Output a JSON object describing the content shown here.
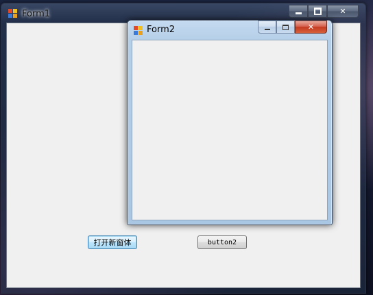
{
  "form1": {
    "title": "Form1",
    "icon": "app-window-icon",
    "caption_buttons": [
      "minimize-icon",
      "maximize-icon",
      "close-icon"
    ],
    "buttons": {
      "open_new_window": "打开新窗体",
      "button2": "button2"
    }
  },
  "form2": {
    "title": "Form2",
    "icon": "app-window-icon",
    "caption_buttons": [
      "minimize-icon",
      "maximize-icon",
      "close-icon"
    ]
  },
  "colors": {
    "client_background": "#f0f0f0",
    "close_button": "#c43a21",
    "active_frame": "#b5cfe8"
  }
}
